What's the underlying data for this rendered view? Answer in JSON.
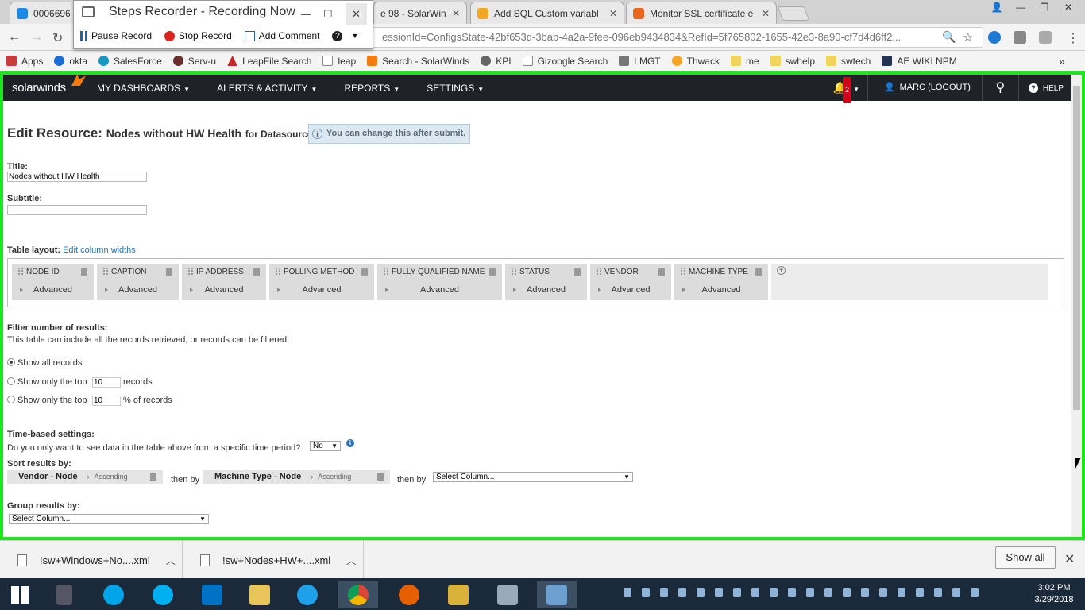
{
  "browser": {
    "tabs": [
      {
        "label": "0006696",
        "color": "#1e88e5"
      },
      {
        "label": "e 98 - SolarWin",
        "color": "#e57c1e"
      },
      {
        "label": "Add SQL Custom variabl",
        "color": "#f5a623"
      },
      {
        "label": "Monitor SSL certificate e",
        "color": "#e8671e"
      }
    ],
    "url": "essionId=ConfigsState-42bf653d-3bab-4a2a-9fee-096eb9434834&RefId=5f765802-1655-42e3-8a90-cf7d4d6ff2...",
    "bookmarks": [
      {
        "label": "Apps",
        "color": "#cc3b3b"
      },
      {
        "label": "okta",
        "color": "#1a6ed8"
      },
      {
        "label": "SalesForce",
        "color": "#1798c1"
      },
      {
        "label": "Serv-u",
        "color": "#6b2e2e"
      },
      {
        "label": "LeapFile Search",
        "color": "#c62828"
      },
      {
        "label": "leap",
        "color": "#888888"
      },
      {
        "label": "Search - SolarWinds",
        "color": "#f57c0c"
      },
      {
        "label": "KPI",
        "color": "#666666"
      },
      {
        "label": "Gizoogle Search",
        "color": "#888888"
      },
      {
        "label": "LMGT",
        "color": "#777777"
      },
      {
        "label": "Thwack",
        "color": "#f5a623"
      },
      {
        "label": "me",
        "color": "#f2d35b"
      },
      {
        "label": "swhelp",
        "color": "#f2d35b"
      },
      {
        "label": "swtech",
        "color": "#f2d35b"
      },
      {
        "label": "AE WIKI NPM",
        "color": "#223355"
      }
    ],
    "bookmarks_more": "»"
  },
  "steps_recorder": {
    "title": "Steps Recorder - Recording Now",
    "pause": "Pause Record",
    "stop": "Stop Record",
    "comment": "Add Comment",
    "help": "?"
  },
  "nav": {
    "logo": "solarwinds",
    "menus": [
      "MY DASHBOARDS",
      "ALERTS & ACTIVITY",
      "REPORTS",
      "SETTINGS"
    ],
    "notif_count": "2",
    "user": "MARC (LOGOUT)",
    "help": "HELP"
  },
  "page": {
    "heading_prefix": "Edit Resource:",
    "resource_name": "Nodes without HW Health",
    "datasource": "for Datasource 1",
    "hint": "You can change this after submit.",
    "title_label": "Title:",
    "title_value": "Nodes without HW Health",
    "subtitle_label": "Subtitle:",
    "subtitle_value": "",
    "table_layout_label": "Table layout:",
    "edit_widths": "Edit column widths",
    "advanced": "Advanced",
    "columns": [
      "NODE ID",
      "CAPTION",
      "IP ADDRESS",
      "POLLING METHOD",
      "FULLY QUALIFIED NAME",
      "STATUS",
      "VENDOR",
      "MACHINE TYPE"
    ],
    "filter_label": "Filter number of results:",
    "filter_desc": "This table can include all the records retrieved, or records can be filtered.",
    "opt_all": "Show all records",
    "opt_top_pre": "Show only the top",
    "opt_top_val": "10",
    "opt_top_post": "records",
    "opt_pct_pre": "Show only the top",
    "opt_pct_val": "10",
    "opt_pct_post": "% of records",
    "time_label": "Time-based settings:",
    "time_question": "Do you only want to see data in the table above from a specific time period?",
    "time_value": "No",
    "sort_label": "Sort results by:",
    "sort1": "Vendor - Node",
    "sort1_dir": "Ascending",
    "then_by": "then by",
    "sort2": "Machine Type - Node",
    "sort2_dir": "Ascending",
    "sort3": "Select Column...",
    "group_label": "Group results by:",
    "group_value": "Select Column..."
  },
  "downloads": {
    "files": [
      "!sw+Windows+No....xml",
      "!sw+Nodes+HW+....xml"
    ],
    "show_all": "Show all"
  },
  "clock": {
    "time": "3:02 PM",
    "date": "3/29/2018"
  }
}
